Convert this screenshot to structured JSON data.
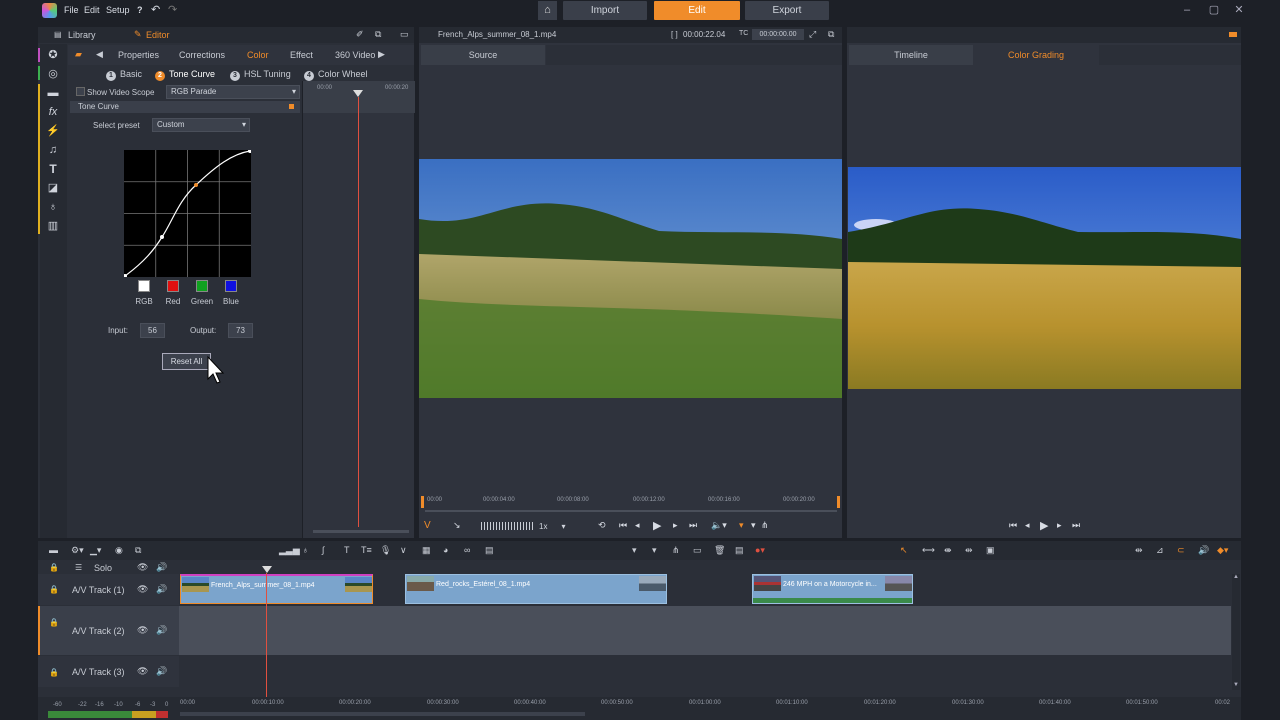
{
  "menu": {
    "file": "File",
    "edit": "Edit",
    "setup": "Setup",
    "help": "?"
  },
  "modes": {
    "import": "Import",
    "edit": "Edit",
    "export": "Export"
  },
  "left_panel": {
    "library_tab": "Library",
    "editor_tab": "Editor",
    "tabs": {
      "properties": "Properties",
      "corrections": "Corrections",
      "color": "Color",
      "effect": "Effect",
      "video360": "360 Video"
    },
    "subtabs": [
      {
        "num": "1",
        "label": "Basic"
      },
      {
        "num": "2",
        "label": "Tone Curve"
      },
      {
        "num": "3",
        "label": "HSL Tuning"
      },
      {
        "num": "4",
        "label": "Color Wheel"
      }
    ],
    "show_video_scope": "Show Video Scope",
    "scope_value": "RGB Parade",
    "section_title": "Tone Curve",
    "select_preset_label": "Select preset",
    "preset_value": "Custom",
    "channels": {
      "rgb": "RGB",
      "red": "Red",
      "green": "Green",
      "blue": "Blue"
    },
    "input_label": "Input:",
    "input_value": "56",
    "output_label": "Output:",
    "output_value": "73",
    "reset_all": "Reset All",
    "mini_ruler": {
      "t0": "00:00",
      "t1": "00:00:20"
    }
  },
  "source_panel": {
    "filename": "French_Alps_summer_08_1.mp4",
    "duration": "00:00:22.04",
    "tc_label": "TC",
    "tc_value": "00:00:00.00",
    "tab": "Source",
    "ruler": [
      "00:00",
      "00:00:04:00",
      "00:00:08:00",
      "00:00:12:00",
      "00:00:16:00",
      "00:00:20:00"
    ],
    "speed": "1x"
  },
  "right_panel": {
    "timeline_tab": "Timeline",
    "grading_tab": "Color Grading"
  },
  "timeline": {
    "solo": "Solo",
    "tracks": [
      "A/V Track (1)",
      "A/V Track (2)",
      "A/V Track (3)"
    ],
    "clips": [
      {
        "title": "French_Alps_summer_08_1.mp4"
      },
      {
        "title": "Red_rocks_Estérel_08_1.mp4"
      },
      {
        "title": "246 MPH on a Motorcycle in..."
      }
    ],
    "ruler": [
      "00:00",
      "00:00:10:00",
      "00:00:20:00",
      "00:00:30:00",
      "00:00:40:00",
      "00:00:50:00",
      "00:01:00:00",
      "00:01:10:00",
      "00:01:20:00",
      "00:01:30:00",
      "00:01:40:00",
      "00:01:50:00",
      "00:02"
    ],
    "meter_labels": [
      "-60",
      "-22",
      "-16",
      "-10",
      "-6",
      "-3",
      "0"
    ]
  },
  "colors": {
    "accent": "#f08c2a",
    "clip": "#7ba4cc",
    "playhead": "#e05040"
  }
}
